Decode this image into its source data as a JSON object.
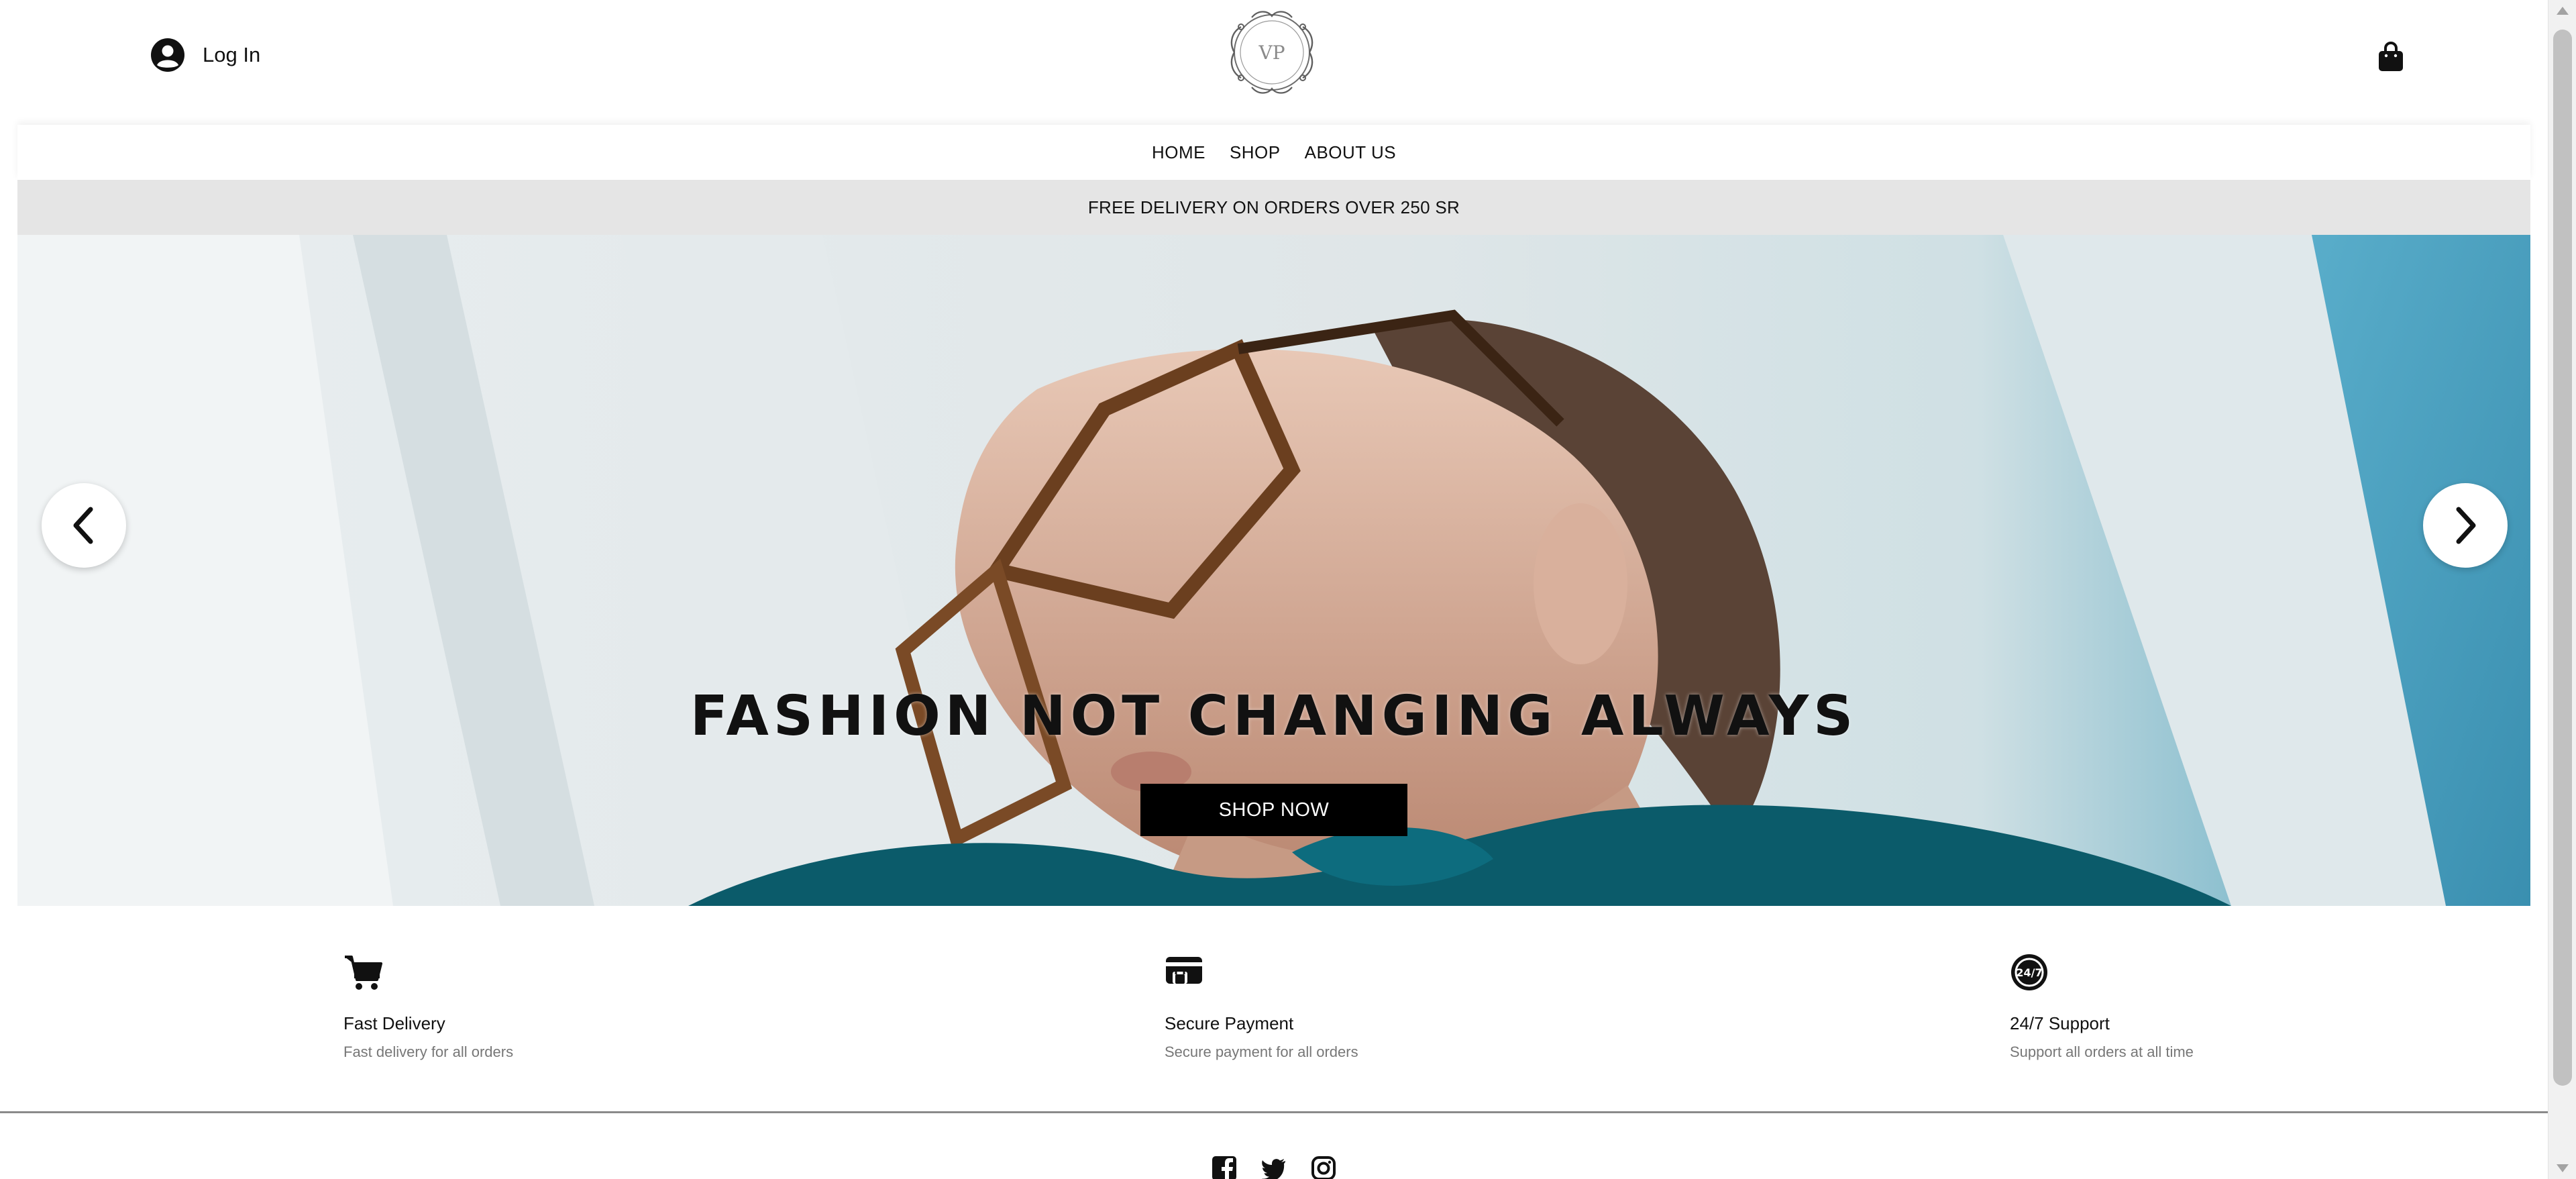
{
  "header": {
    "login_label": "Log In"
  },
  "nav": {
    "items": [
      {
        "label": "HOME"
      },
      {
        "label": "SHOP"
      },
      {
        "label": "ABOUT US"
      }
    ]
  },
  "announcement": "FREE DELIVERY ON ORDERS OVER 250 SR",
  "hero": {
    "title": "FASHION NOT CHANGING ALWAYS",
    "button_label": "SHOP NOW",
    "prev_icon": "chevron-left-icon",
    "next_icon": "chevron-right-icon"
  },
  "features": [
    {
      "icon": "cart-icon",
      "title": "Fast Delivery",
      "description": "Fast delivery for all orders"
    },
    {
      "icon": "credit-card-icon",
      "title": "Secure Payment",
      "description": "Secure payment for all orders"
    },
    {
      "icon": "support-24-7-icon",
      "title": "24/7 Support",
      "description": "Support all orders at all time"
    }
  ],
  "footer": {
    "socials": [
      "facebook-icon",
      "twitter-icon",
      "instagram-icon"
    ]
  },
  "colors": {
    "accent": "#000000",
    "announcement_bg": "#e5e5e5",
    "muted_text": "#777777"
  }
}
